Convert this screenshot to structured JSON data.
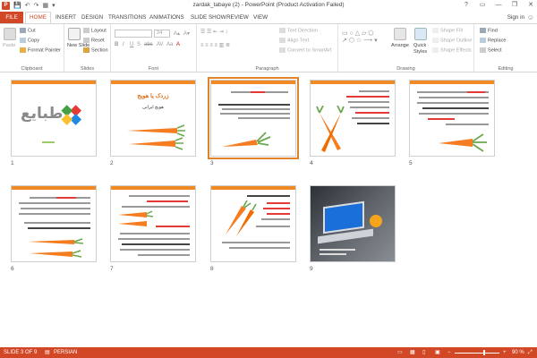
{
  "window": {
    "title": "zardak_tabaye (2) - PowerPoint (Product Activation Failed)",
    "app_badge": "P",
    "qat": [
      "💾",
      "↶",
      "↷",
      "▦",
      "▾"
    ],
    "controls": [
      "?",
      "▭",
      "—",
      "❐",
      "✕"
    ]
  },
  "tabs": [
    {
      "label": "FILE"
    },
    {
      "label": "HOME"
    },
    {
      "label": "INSERT"
    },
    {
      "label": "DESIGN"
    },
    {
      "label": "TRANSITIONS"
    },
    {
      "label": "ANIMATIONS"
    },
    {
      "label": "SLIDE SHOW"
    },
    {
      "label": "REVIEW"
    },
    {
      "label": "VIEW"
    }
  ],
  "signin": "Sign in",
  "ribbon": {
    "clipboard": {
      "paste": "Paste",
      "cut": "Cut",
      "copy": "Copy",
      "format_painter": "Format Painter",
      "label": "Clipboard"
    },
    "slides": {
      "new_slide": "New Slide",
      "layout": "Layout",
      "reset": "Reset",
      "section": "Section",
      "label": "Slides"
    },
    "font": {
      "font_size": "24",
      "label": "Font",
      "buttons": [
        "B",
        "I",
        "U",
        "S",
        "abc",
        "AV",
        "Aa",
        "A"
      ]
    },
    "paragraph": {
      "text_direction": "Text Direction",
      "align_text": "Align Text",
      "convert_smartart": "Convert to SmartArt",
      "label": "Paragraph"
    },
    "drawing": {
      "arrange": "Arrange",
      "quick_styles": "Quick Styles",
      "shape_fill": "Shape Fill",
      "shape_outline": "Shape Outline",
      "shape_effects": "Shape Effects",
      "label": "Drawing"
    },
    "editing": {
      "find": "Find",
      "replace": "Replace",
      "select": "Select",
      "label": "Editing"
    }
  },
  "slides": [
    {
      "number": "1"
    },
    {
      "number": "2",
      "title": "زردک یا هویج",
      "subtitle": "هویج ایرانی"
    },
    {
      "number": "3"
    },
    {
      "number": "4"
    },
    {
      "number": "5"
    },
    {
      "number": "6"
    },
    {
      "number": "7"
    },
    {
      "number": "8"
    },
    {
      "number": "9"
    }
  ],
  "logo_text": "طبایع",
  "status": {
    "slide_info": "SLIDE 3 OF 9",
    "language": "PERSIAN",
    "zoom": "90 %",
    "zoom_minus": "−",
    "zoom_plus": "+"
  },
  "colors": {
    "accent": "#d24726",
    "slide_bar": "#f08a24",
    "carrot": "#f57c1f",
    "leaf": "#6aa84f"
  },
  "selected_slide_index": 3
}
